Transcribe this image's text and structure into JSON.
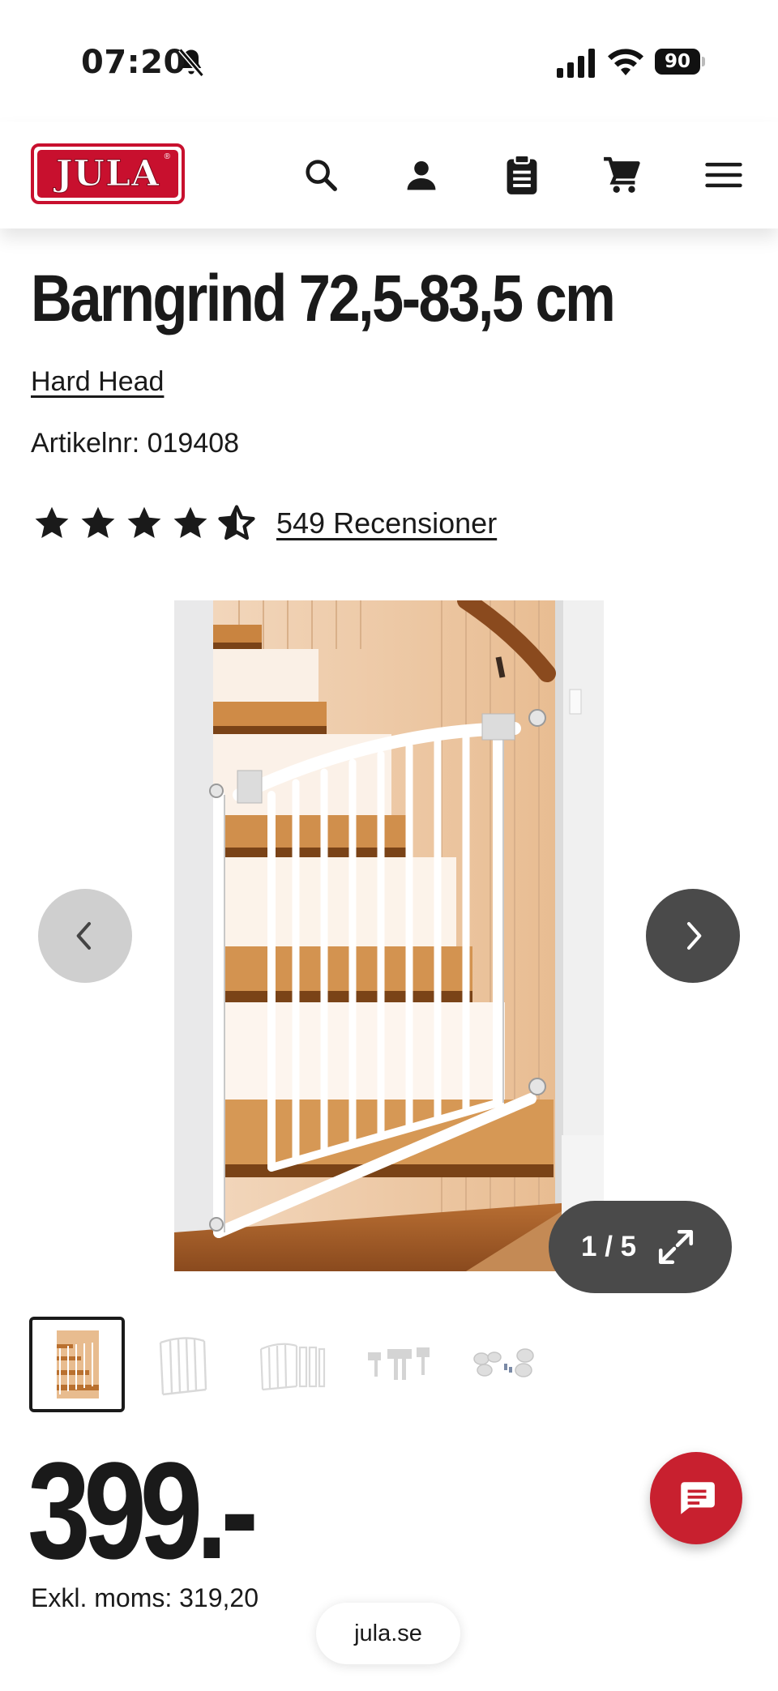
{
  "status_bar": {
    "time": "07:20",
    "battery": "90",
    "icons": [
      "bell-slash-icon",
      "signal-icon",
      "wifi-icon",
      "battery-icon"
    ]
  },
  "header": {
    "logo_text": "JULA",
    "logo_mark": "®",
    "brand_color": "#c8102e",
    "icons": [
      "search-icon",
      "user-icon",
      "clipboard-icon",
      "cart-icon",
      "menu-icon"
    ]
  },
  "product": {
    "title": "Barngrind 72,5-83,5 cm",
    "brand": "Hard Head",
    "article_number": "Artikelnr: 019408",
    "rating": 4.5,
    "rating_max": 5,
    "reviews_label": "549 Recensioner"
  },
  "gallery": {
    "counter": "1 / 5",
    "image_count": 5,
    "current_index": 1,
    "thumbnails": [
      "thumb-gate-stairs",
      "thumb-gate-front",
      "thumb-gate-extended",
      "thumb-gate-parts",
      "thumb-wall-cups"
    ]
  },
  "pricing": {
    "price": "399.-",
    "excl_vat": "Exkl. moms: 319,20"
  },
  "chat": {
    "icon": "chat-icon",
    "color": "#c8202f"
  },
  "browser": {
    "url": "jula.se"
  }
}
